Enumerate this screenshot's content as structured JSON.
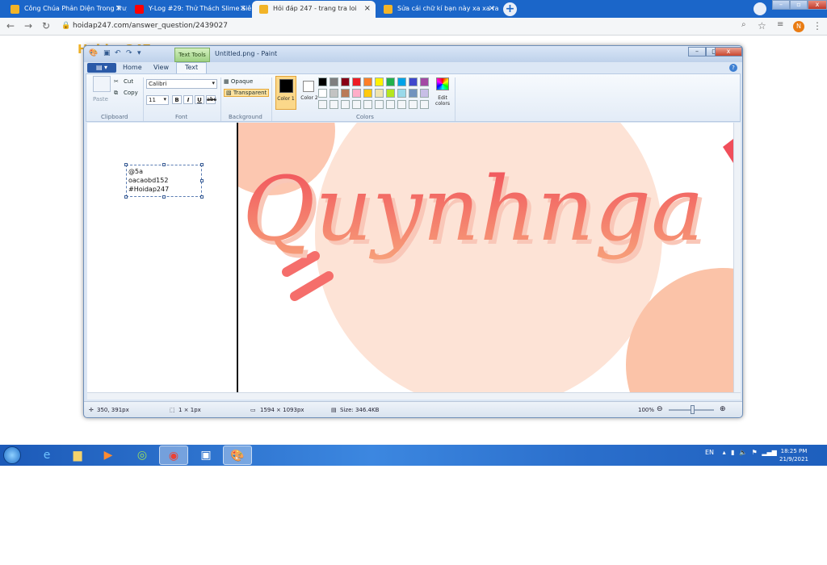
{
  "browser": {
    "tabs": [
      {
        "title": "Công Chúa Phản Diện Trong Truy",
        "favicon_color": "#f2b428"
      },
      {
        "title": "Y-Log #29: Thử Thách Slime Siêu",
        "favicon_color": "#ff0000"
      },
      {
        "title": "Hỏi đáp 247 - trang tra loi",
        "favicon_color": "#f2b428"
      },
      {
        "title": "Sửa cái chữ kí bạn này xa xa ra x",
        "favicon_color": "#f2b428"
      }
    ],
    "new_tab": "+",
    "url": "hoidap247.com/answer_question/2439027",
    "avatar_letter": "N"
  },
  "website": {
    "logo": "Hoidap247"
  },
  "paint": {
    "title": "Untitled.png - Paint",
    "context_tab": "Text Tools",
    "ribbon_tabs": {
      "home": "Home",
      "view": "View",
      "text": "Text"
    },
    "clipboard": {
      "paste": "Paste",
      "cut": "Cut",
      "copy": "Copy",
      "label": "Clipboard"
    },
    "font": {
      "family": "Calibri",
      "size": "11",
      "bold": "B",
      "italic": "I",
      "underline": "U",
      "strike": "abc",
      "label": "Font"
    },
    "background": {
      "opaque": "Opaque",
      "transparent": "Transparent",
      "label": "Background"
    },
    "colors": {
      "color1": "Color 1",
      "color2": "Color 2",
      "edit": "Edit colors",
      "label": "Colors",
      "palette_row1": [
        "#000000",
        "#7f7f7f",
        "#880015",
        "#ed1c24",
        "#ff7f27",
        "#fff200",
        "#22b14c",
        "#00a2e8",
        "#3f48cc",
        "#a349a4"
      ],
      "palette_row2": [
        "#ffffff",
        "#c3c3c3",
        "#b97a57",
        "#ffaec9",
        "#ffc90e",
        "#efe4b0",
        "#b5e61d",
        "#99d9ea",
        "#7092be",
        "#c8bfe7"
      ]
    },
    "textbox_lines": [
      "@5a",
      "oacaobd152",
      "#Hoidap247"
    ],
    "artwork_text": "Quynhnga",
    "status": {
      "cursor": "350, 391px",
      "selection": "1 × 1px",
      "dimensions": "1594 × 1093px",
      "size": "Size: 346.4KB",
      "zoom": "100%"
    }
  },
  "taskbar": {
    "language": "EN",
    "time": "18:25 PM",
    "date": "21/9/2021"
  }
}
